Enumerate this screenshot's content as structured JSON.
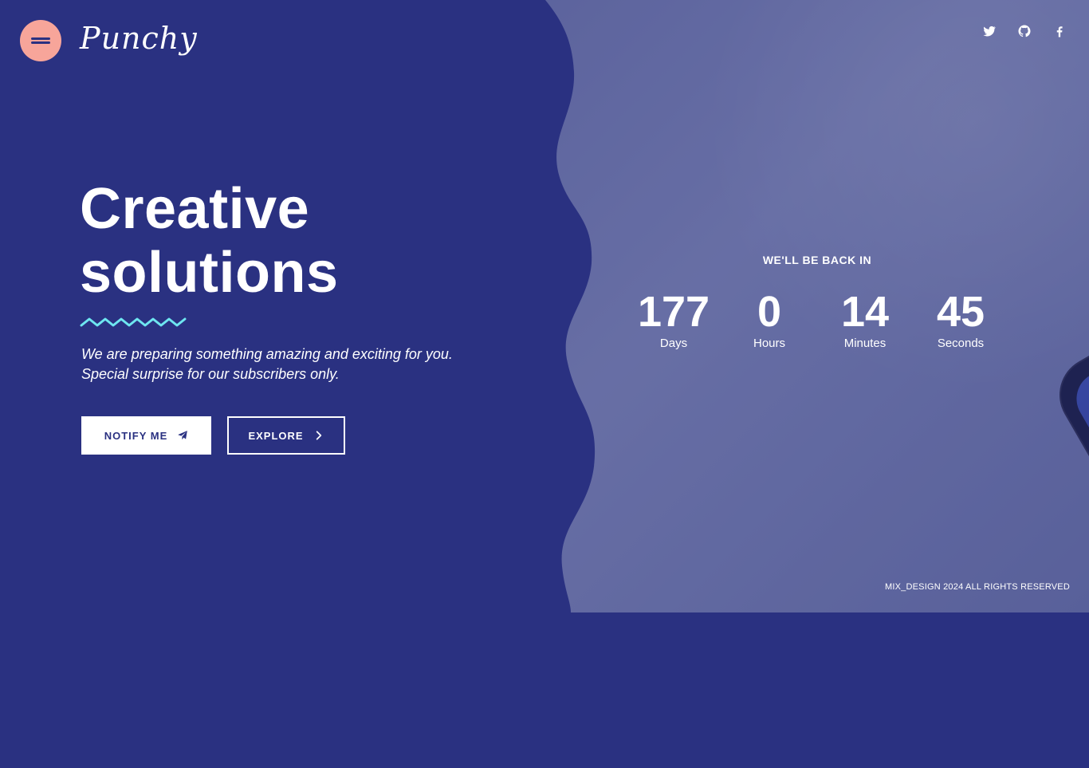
{
  "header": {
    "logo_text": "Punchy",
    "menu_icon": "hamburger-menu-icon",
    "social": [
      {
        "name": "twitter",
        "icon": "twitter-icon"
      },
      {
        "name": "github",
        "icon": "github-icon"
      },
      {
        "name": "facebook",
        "icon": "facebook-icon"
      }
    ]
  },
  "hero": {
    "title_line1": "Creative",
    "title_line2": "solutions",
    "subtitle": "We are preparing something amazing and exciting for you. Special surprise for our subscribers only.",
    "buttons": {
      "notify_label": "NOTIFY ME",
      "explore_label": "EXPLORE"
    }
  },
  "countdown": {
    "heading": "WE'LL BE BACK IN",
    "items": [
      {
        "value": "177",
        "label": "Days"
      },
      {
        "value": "0",
        "label": "Hours"
      },
      {
        "value": "14",
        "label": "Minutes"
      },
      {
        "value": "45",
        "label": "Seconds"
      }
    ]
  },
  "footer": {
    "copyright": "MIX_DESIGN 2024 ALL RIGHTS RESERVED"
  },
  "colors": {
    "primary_blue": "#2a3181",
    "menu_pink": "#f7a59a",
    "squiggle_cyan": "#6ee6f0",
    "white": "#ffffff"
  }
}
